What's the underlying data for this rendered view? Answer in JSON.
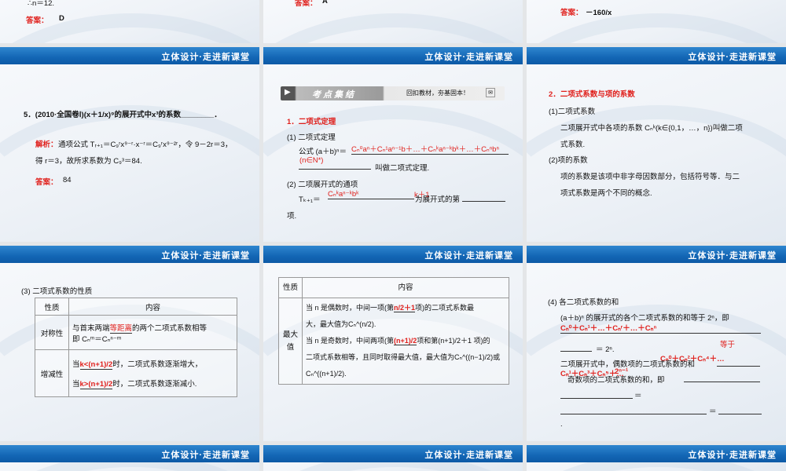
{
  "banner_text": "立体设计·走进新课堂",
  "colors": {
    "banner": "#1366b5",
    "red": "#e0201c"
  },
  "s_top_left": {
    "line": "∴n＝12.",
    "answer_label": "答案：",
    "answer": "D"
  },
  "s_top_mid": {
    "answer_label": "答案：",
    "answer": "A"
  },
  "s_top_right": {
    "answer_label": "答案：",
    "answer": "－160/x"
  },
  "s1": {
    "question": "5．(2010·全国卷Ⅰ)(x＋1/x)⁹的展开式中x³的系数________．",
    "analysis_label": "解析：",
    "analysis1": "通项公式 Tᵣ₊₁＝C₉ʳx⁹⁻ʳ·x⁻ʳ＝C₉ʳx⁹⁻²ʳ，令 9－2r＝3，",
    "analysis2": "得 r＝3，故所求系数为 C₉³＝84.",
    "answer_label": "答案：",
    "answer": "84"
  },
  "s2": {
    "header_title": "考点集结",
    "header_sub": "回扣教材，夯基固本！",
    "h1": "1．二项式定理",
    "p1": "(1) 二项式定理",
    "formula_prefix": "公式 (a＋b)ⁿ＝",
    "formula_red": "Cₙ⁰aⁿ＋Cₙ¹aⁿ⁻¹b＋…＋Cₙᵏaⁿ⁻ᵏbᵏ＋…＋Cₙⁿbⁿ",
    "formula_cond": "(n∈N*)",
    "formula_suffix": "叫做二项式定理.",
    "p2": "(2) 二项展开式的通项",
    "term_prefix": "Tₖ₊₁＝",
    "term_red": "Cₙᵏaⁿ⁻ᵏbᵏ",
    "term_mid": "为展开式的第",
    "term_red2": "k＋1",
    "term_end": "项."
  },
  "s3": {
    "h1": "2．二项式系数与项的系数",
    "p1": "(1)二项式系数",
    "p1a": "二项展开式中各项的系数 Cₙᵏ(k∈{0,1，…，n})叫做二项",
    "p1b": "式系数.",
    "p2": "(2)项的系数",
    "p2a": "项的系数是该项中非字母因数部分，包括符号等．与二",
    "p2b": "项式系数是两个不同的概念."
  },
  "s4": {
    "title": "(3) 二项式系数的性质",
    "col1": "性质",
    "col2": "内容",
    "row1_label": "对称性",
    "row1_a": "与首末两端",
    "row1_red": "等距离",
    "row1_b": "的两个二项式系数相等",
    "row1_c": "即 Cₙᵐ＝Cₙⁿ⁻ᵐ",
    "row2_label": "增减性",
    "row2_a": "当",
    "row2_red_a": "k<(n+1)/2",
    "row2_a2": "时，二项式系数逐渐增大，",
    "row2_b": "当",
    "row2_red_b": "k>(n+1)/2",
    "row2_b2": "时，二项式系数逐渐减小."
  },
  "s5": {
    "col1": "性质",
    "col2": "内容",
    "row_label": "最大值",
    "l1a": "当 n 是偶数时，中间一项(第",
    "l1red": "n/2＋1",
    "l1b": "项)的二项式系数最",
    "l2": "大，最大值为Cₙ^(n/2).",
    "l3a": "当 n 是奇数时，中间两项(第",
    "l3red": "(n+1)/2",
    "l3b": "项和第(n+1)/2＋1 项)的",
    "l4": "二项式系数相等，且同时取得最大值，最大值为Cₙ^((n−1)/2)或",
    "l5": "Cₙ^((n+1)/2)."
  },
  "s6": {
    "title": "(4) 各二项式系数的和",
    "l1": "(a＋b)ⁿ 的展开式的各个二项式系数的和等于 2ⁿ，即",
    "l1red": "Cₙ⁰＋Cₙ¹＋…＋Cₙʳ＋…＋Cₙⁿ",
    "l2": "＝ 2ⁿ.",
    "red_dengyu": "等于",
    "l3": "二项展开式中，偶数项的二项式系数的和",
    "l3red": "Cₙ⁰＋Cₙ²＋Cₙ⁴＋…",
    "l4": "奇数项的二项式系数的和，即",
    "l4red": "Cₙ¹＋Cₙ³＋Cₙ⁵＋…",
    "l4red2": "2ⁿ⁻¹",
    "eq": "＝",
    "l6": "."
  }
}
